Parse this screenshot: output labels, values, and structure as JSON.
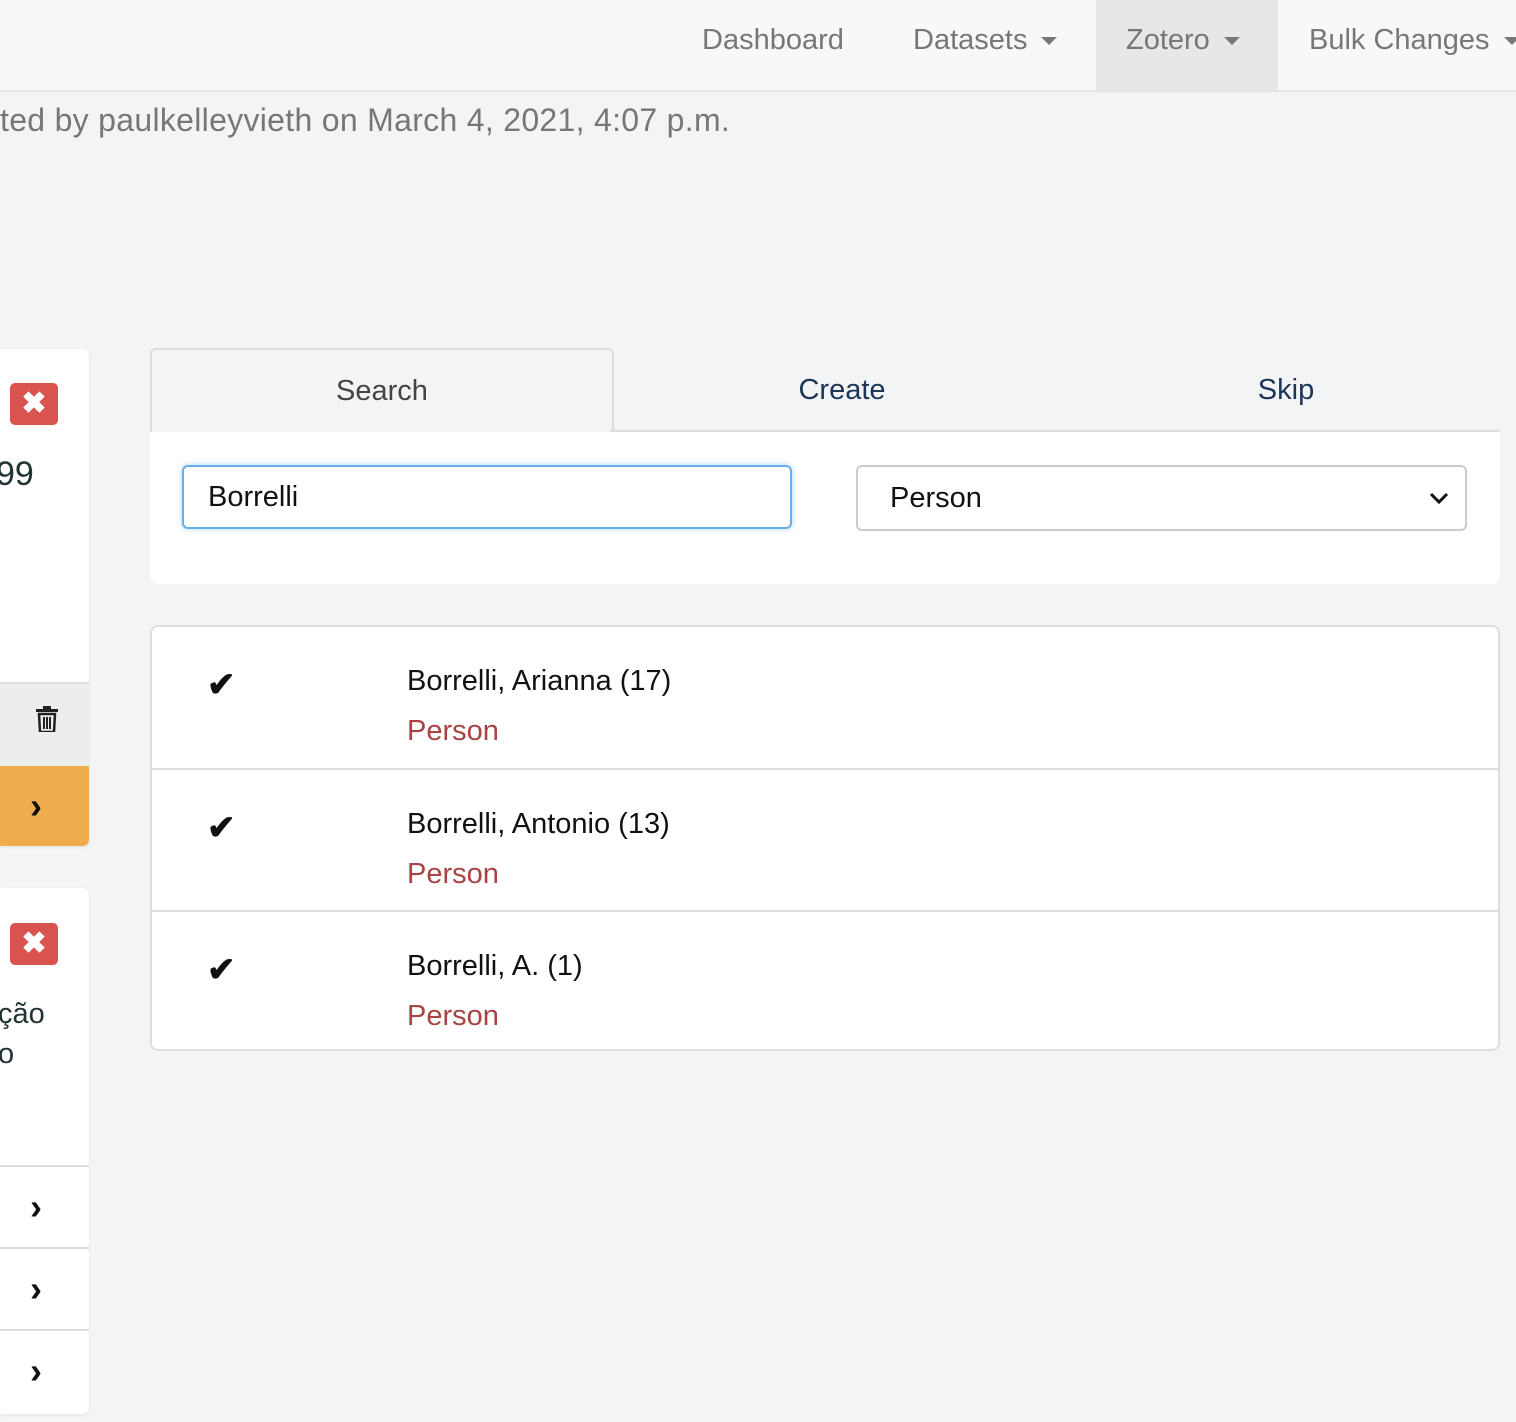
{
  "navbar": {
    "items": [
      {
        "label": "Dashboard",
        "dropdown": false,
        "active": false
      },
      {
        "label": "Datasets",
        "dropdown": true,
        "active": false
      },
      {
        "label": "Zotero",
        "dropdown": true,
        "active": true
      },
      {
        "label": "Bulk Changes",
        "dropdown": true,
        "active": false
      }
    ]
  },
  "subtitle": "ted by paulkelleyvieth on March 4, 2021, 4:07 p.m.",
  "left_cards": {
    "card1": {
      "number_fragment": "99",
      "close_icon": "close-icon",
      "delete_icon": "trash-icon",
      "next_icon": "chevron-right-icon"
    },
    "card2": {
      "text_line1": "ção",
      "text_line2": "o",
      "close_icon": "close-icon",
      "next_icon": "chevron-right-icon"
    }
  },
  "tabs": [
    {
      "label": "Search",
      "active": true
    },
    {
      "label": "Create",
      "active": false
    },
    {
      "label": "Skip",
      "active": false
    }
  ],
  "search": {
    "query": "Borrelli",
    "type_selected": "Person"
  },
  "results": [
    {
      "name": "Borrelli, Arianna (17)",
      "type": "Person"
    },
    {
      "name": "Borrelli, Antonio (13)",
      "type": "Person"
    },
    {
      "name": "Borrelli, A. (1)",
      "type": "Person"
    }
  ],
  "colors": {
    "accent_orange": "#f0ad4e",
    "danger_red": "#d9534f",
    "type_text": "#a94442",
    "focus_blue": "#66afe9"
  }
}
